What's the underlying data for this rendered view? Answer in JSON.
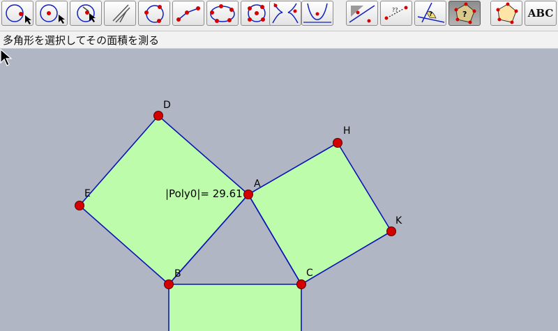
{
  "toolbar": {
    "tools": [
      {
        "name": "point-on-circle-tool-icon"
      },
      {
        "name": "point-in-circle-tool-icon"
      },
      {
        "name": "center-pick-tool-icon"
      },
      {
        "name": "compass-tool-icon"
      },
      {
        "name": "circle-tool-icon"
      },
      {
        "name": "segment-tool-icon"
      },
      {
        "name": "ellipse-tool-icon"
      },
      {
        "name": "conic-five-points-tool-icon"
      },
      {
        "name": "locus-tool-icon"
      },
      {
        "name": "parabola-tool-icon"
      },
      {
        "name": "area-shade-tool-icon"
      },
      {
        "name": "distance-measure-tool-icon"
      },
      {
        "name": "angle-measure-tool-icon"
      },
      {
        "name": "polygon-area-tool-icon",
        "pressed": true
      },
      {
        "name": "polygon-label-tool-icon"
      },
      {
        "name": "text-tool-icon",
        "label": "ABC"
      }
    ]
  },
  "status": {
    "message": "多角形を選択してその面積を測る"
  },
  "canvas": {
    "background": "#b0b6c4",
    "polygon_fill": "#bdfcaa",
    "edge_color": "#0a14b4",
    "point_color": "#d40000",
    "points": [
      {
        "label": "D"
      },
      {
        "label": "H"
      },
      {
        "label": "A"
      },
      {
        "label": "E"
      },
      {
        "label": "K"
      },
      {
        "label": "B"
      },
      {
        "label": "C"
      }
    ],
    "measurement": "|Poly0|= 29.61"
  }
}
